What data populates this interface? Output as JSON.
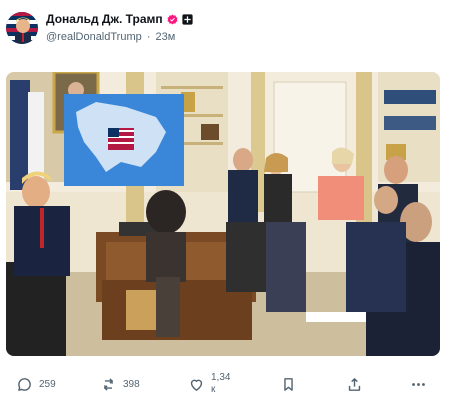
{
  "post": {
    "author_name": "Дональд Дж. Трамп",
    "handle": "@realDonaldTrump",
    "separator": "·",
    "time": "23м"
  },
  "stats": {
    "replies": "259",
    "reposts": "398",
    "likes_value": "1,34",
    "likes_suffix": "к"
  },
  "icons": {
    "verified": "verified-badge-icon",
    "affiliation": "affiliation-badge-icon",
    "reply": "comment-icon",
    "repost": "repost-icon",
    "like": "heart-icon",
    "bookmark": "bookmark-icon",
    "share": "share-icon",
    "more": "more-icon"
  },
  "colors": {
    "verified": "#f91880",
    "muted": "#536471",
    "text": "#0f1419"
  }
}
